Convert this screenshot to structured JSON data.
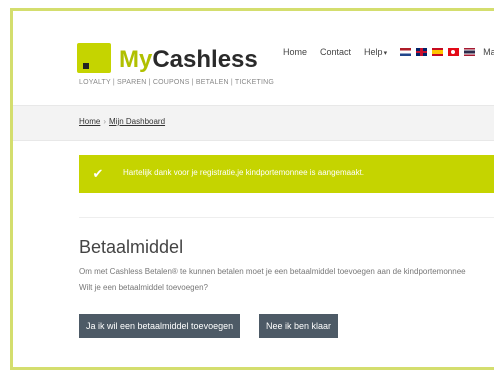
{
  "header": {
    "logo_my": "My",
    "logo_cashless": "Cashless",
    "tagline": "LOYALTY | SPAREN | COUPONS | BETALEN | TICKETING",
    "nav": [
      "Home",
      "Contact",
      "Help"
    ],
    "help_caret": "▾",
    "user": "Marvi",
    "flags": [
      "nl-flag-icon",
      "uk-flag-icon",
      "es-flag-icon",
      "tr-flag-icon",
      "th-flag-icon"
    ]
  },
  "breadcrumb": {
    "home": "Home",
    "separator": "›",
    "current": "Mijn Dashboard"
  },
  "alert": {
    "message": "Hartelijk dank voor je registratie,je kindportemonnee is aangemaakt.",
    "accent": "#c5d400"
  },
  "main": {
    "title": "Betaalmiddel",
    "line1": "Om met Cashless Betalen® te kunnen betalen moet je een betaalmiddel toevoegen aan de kindportemonnee",
    "line2": "Wilt je een betaalmiddel toevoegen?",
    "yes_label": "Ja ik wil een betaalmiddel toevoegen",
    "no_label": "Nee ik ben klaar"
  },
  "colors": {
    "brand": "#c5d400",
    "button": "#4d5a66"
  }
}
